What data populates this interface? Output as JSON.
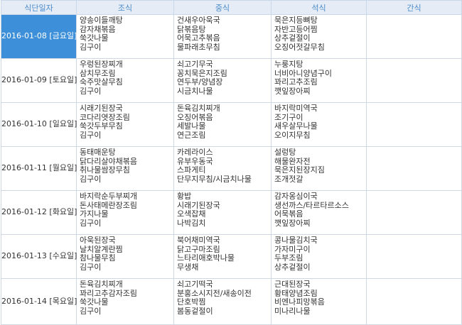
{
  "columns": [
    "식단일자",
    "조식",
    "중식",
    "석식",
    "간식"
  ],
  "rows": [
    {
      "date": "2016-01-08 [금요일]",
      "breakfast": [
        "양송이들깨탕",
        "감자채볶음",
        "쑥갓나물",
        "김구이"
      ],
      "lunch": [
        "건새우아욱국",
        "닭볶음탕",
        "어묵고추볶음",
        "물파래초무침"
      ],
      "dinner": [
        "묵은지등뼈탕",
        "자반고등어찜",
        "상추겉절이",
        "오징어젓갈무침"
      ],
      "snack": []
    },
    {
      "date": "2016-01-09 [토요일]",
      "breakfast": [
        "우렁된장찌개",
        "삼치무조림",
        "숙주맛살무침",
        "김구이"
      ],
      "lunch": [
        "쇠고기무국",
        "꽁치묵은지조림",
        "연두부/양념장",
        "시금치나물"
      ],
      "dinner": [
        "누룽지탕",
        "너비아니양념구이",
        "꽈리고추조림",
        "깻잎장아찌"
      ],
      "snack": []
    },
    {
      "date": "2016-01-10 [일요일]",
      "breakfast": [
        "시래기된장국",
        "코다리엿장조림",
        "쑥갓두부무침",
        "김구이"
      ],
      "lunch": [
        "돈육김치찌개",
        "오징어볶음",
        "세발나물",
        "연근조림"
      ],
      "dinner": [
        "바지락미역국",
        "조기구이",
        "새우살무나물",
        "오이지무침"
      ],
      "snack": []
    },
    {
      "date": "2016-01-11 [월요일]",
      "breakfast": [
        "동태매운탕",
        "닭다리살야채볶음",
        "취나물쌈장무침",
        "김구이"
      ],
      "lunch": [
        "카레라이스",
        "유부우동국",
        "스파게티",
        "단무지무침/시금치나물"
      ],
      "dinner": [
        "설렁탕",
        "해물완자전",
        "묵은지된장지짐",
        "조개젓갈"
      ],
      "snack": []
    },
    {
      "date": "2016-01-12 [화요일]",
      "breakfast": [
        "바지락순두부찌개",
        "돈사태메란장조림",
        "가지나물",
        "김구이"
      ],
      "lunch": [
        "황밥",
        "시래기된장국",
        "오색잡채",
        "나박김치"
      ],
      "dinner": [
        "감자옹심이국",
        "생선까스/타르타르소스",
        "어묵볶음",
        "깻잎장아찌"
      ],
      "snack": []
    },
    {
      "date": "2016-01-13 [수요일]",
      "breakfast": [
        "아욱된장국",
        "날치알계란찜",
        "참나물무침",
        "김구이"
      ],
      "lunch": [
        "북어채미역국",
        "닭고구마조림",
        "느타리애호박나물",
        "무생채"
      ],
      "dinner": [
        "콩나물김치국",
        "가자미구이",
        "두부조림",
        "상추겉절이"
      ],
      "snack": []
    },
    {
      "date": "2016-01-14 [목요일]",
      "breakfast": [
        "돈육김치찌개",
        "꽈리고추감자조림",
        "쑥갓나물",
        "김구이"
      ],
      "lunch": [
        "쇠고기떡국",
        "분홍소시지전/새송이전",
        "단호박찜",
        "봄동겉절이"
      ],
      "dinner": [
        "근대된장국",
        "황태양념조림",
        "비엔나피망볶음",
        "미나리나물"
      ],
      "snack": []
    }
  ],
  "selected_row_color": "#3d8fd9",
  "header_color": "#e5ecf6"
}
